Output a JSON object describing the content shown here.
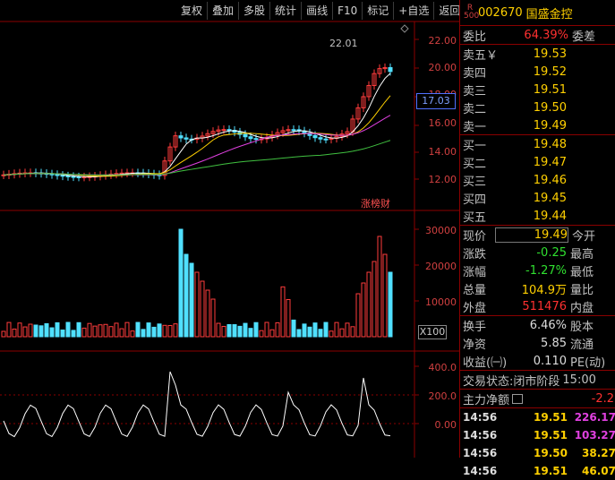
{
  "toolbar": {
    "items": [
      "复权",
      "叠加",
      "多股",
      "统计",
      "画线",
      "F10",
      "标记",
      "+自选",
      "返回"
    ]
  },
  "chart": {
    "price_axis": [
      "22.00",
      "20.00",
      "18.00",
      "16.00",
      "14.00",
      "12.00"
    ],
    "volume_axis": [
      "30000",
      "20000",
      "10000"
    ],
    "indicator_axis": [
      "400.0",
      "200.0",
      "0.00"
    ],
    "current_price_tag": "17.03",
    "peak_label": "22.01",
    "zbc_label": "涨榜财",
    "vol_unit": "X100"
  },
  "chart_data": {
    "type": "candlestick",
    "colors": {
      "up": "#ff3c3c",
      "down": "#50e0ff",
      "ma5": "#ffffff",
      "ma10": "#ffd000",
      "ma20": "#e040e0",
      "ma60": "#40c040"
    }
  },
  "stock": {
    "market_badge": "R\n500",
    "code": "002670",
    "name": "国盛金控"
  },
  "quote": {
    "committee_ratio": {
      "label": "委比",
      "value": "64.39%",
      "label2": "委差"
    },
    "asks": [
      {
        "label": "卖五￥",
        "price": "19.53"
      },
      {
        "label": "卖四",
        "price": "19.52"
      },
      {
        "label": "卖三",
        "price": "19.51"
      },
      {
        "label": "卖二",
        "price": "19.50"
      },
      {
        "label": "卖一",
        "price": "19.49"
      }
    ],
    "bids": [
      {
        "label": "买一",
        "price": "19.48"
      },
      {
        "label": "买二",
        "price": "19.47"
      },
      {
        "label": "买三",
        "price": "19.46"
      },
      {
        "label": "买四",
        "price": "19.45"
      },
      {
        "label": "买五",
        "price": "19.44"
      }
    ],
    "stats": [
      {
        "label": "现价",
        "value": "19.49",
        "label2": "今开"
      },
      {
        "label": "涨跌",
        "value": "-0.25",
        "label2": "最高"
      },
      {
        "label": "涨幅",
        "value": "-1.27%",
        "label2": "最低"
      },
      {
        "label": "总量",
        "value": "104.9万",
        "label2": "量比"
      },
      {
        "label": "外盘",
        "value": "511476",
        "label2": "内盘"
      }
    ],
    "fundamentals": [
      {
        "label": "换手",
        "value": "6.46%",
        "label2": "股本"
      },
      {
        "label": "净资",
        "value": "5.85",
        "label2": "流通"
      },
      {
        "label": "收益(㈠)",
        "value": "0.110",
        "label2": "PE(动)"
      }
    ],
    "trade_status": {
      "label": "交易状态:",
      "value": "闭市阶段",
      "time": "15:00"
    },
    "main_net": {
      "label": "主力净额",
      "value": "-2.2"
    },
    "ticks": [
      {
        "time": "14:56",
        "price": "19.51",
        "vol": "226.17",
        "vol_color": "#e040e0"
      },
      {
        "time": "14:56",
        "price": "19.51",
        "vol": "103.27",
        "vol_color": "#e040e0"
      },
      {
        "time": "14:56",
        "price": "19.50",
        "vol": "38.27",
        "vol_color": "#ffd000"
      },
      {
        "time": "14:56",
        "price": "19.51",
        "vol": "46.07",
        "vol_color": "#ffd000"
      }
    ]
  }
}
